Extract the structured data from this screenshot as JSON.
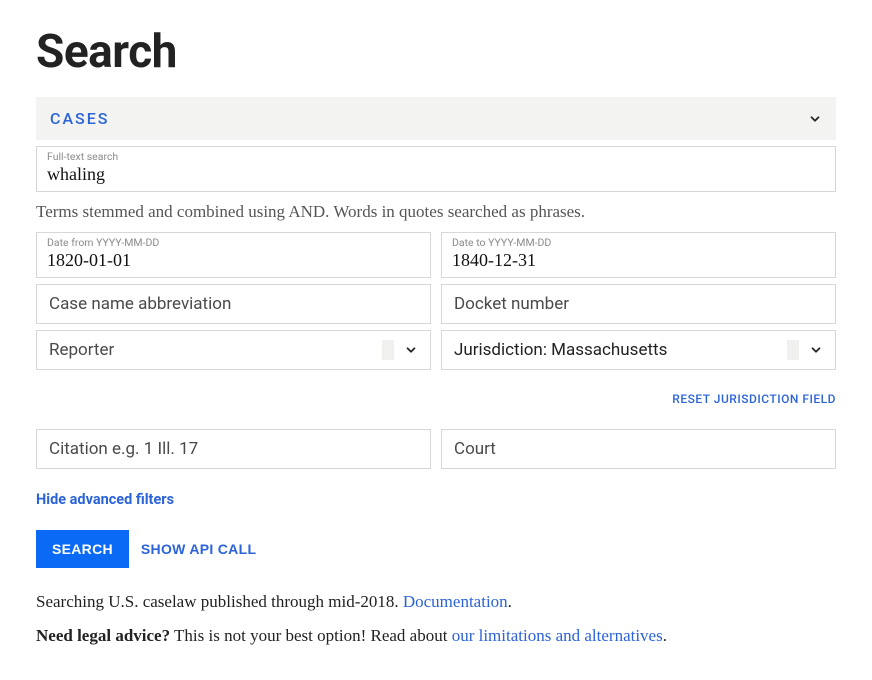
{
  "page": {
    "title": "Search"
  },
  "tabs": {
    "active_label": "CASES"
  },
  "fulltext": {
    "label": "Full-text search",
    "value": "whaling",
    "helper": "Terms stemmed and combined using AND. Words in quotes searched as phrases."
  },
  "date_from": {
    "label": "Date from YYYY-MM-DD",
    "value": "1820-01-01"
  },
  "date_to": {
    "label": "Date to YYYY-MM-DD",
    "value": "1840-12-31"
  },
  "case_name": {
    "placeholder": "Case name abbreviation"
  },
  "docket": {
    "placeholder": "Docket number"
  },
  "reporter": {
    "placeholder": "Reporter"
  },
  "jurisdiction": {
    "display": "Jurisdiction: Massachusetts"
  },
  "reset_link": "RESET JURISDICTION FIELD",
  "citation": {
    "placeholder": "Citation e.g. 1 Ill. 17"
  },
  "court": {
    "placeholder": "Court"
  },
  "hide_filters": "Hide advanced filters",
  "buttons": {
    "search": "SEARCH",
    "show_api": "SHOW API CALL"
  },
  "info1": {
    "prefix": "Searching U.S. caselaw published through mid-2018. ",
    "link": "Documentation",
    "suffix": "."
  },
  "info2": {
    "strong": "Need legal advice?",
    "middle": " This is not your best option! Read about ",
    "link": "our limitations and alternatives",
    "suffix": "."
  }
}
